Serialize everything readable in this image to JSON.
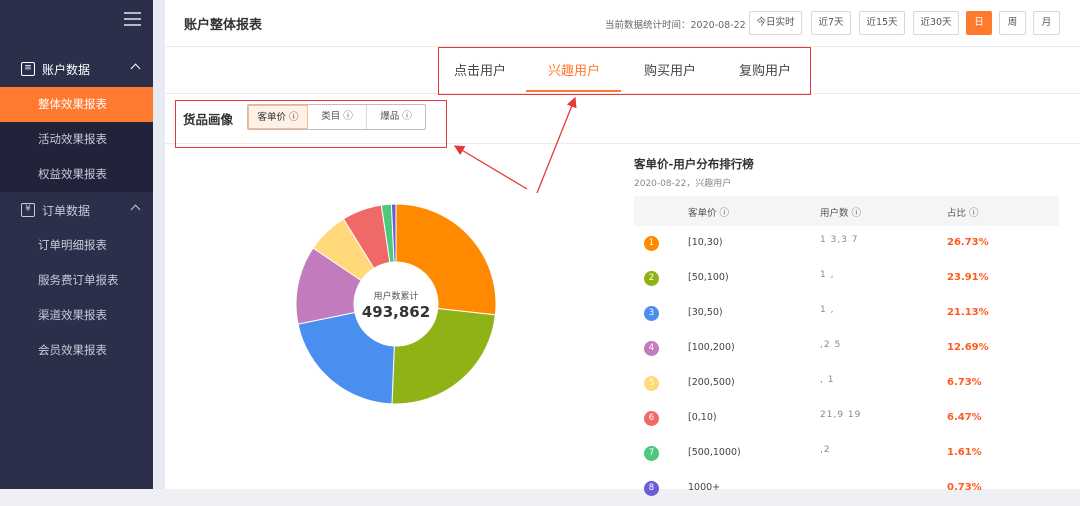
{
  "sidebar": {
    "groups": [
      {
        "label": "账户数据",
        "items": [
          "整体效果报表",
          "活动效果报表",
          "权益效果报表"
        ]
      },
      {
        "label": "订单数据",
        "items": [
          "订单明细报表",
          "服务费订单报表",
          "渠道效果报表",
          "会员效果报表"
        ]
      }
    ],
    "active_item": "整体效果报表"
  },
  "header": {
    "title": "账户整体报表",
    "stat_time": "当前数据统计时间：2020-08-22",
    "ranges": [
      "今日实时",
      "近7天",
      "近15天",
      "近30天",
      "日",
      "周",
      "月"
    ],
    "active_range": "日"
  },
  "tabs": {
    "items": [
      "点击用户",
      "兴趣用户",
      "购买用户",
      "复购用户"
    ],
    "active": "兴趣用户"
  },
  "section": {
    "label": "货品画像",
    "segments": [
      "客单价 ⓘ",
      "类目 ⓘ",
      "爆品 ⓘ"
    ],
    "active_segment": "客单价 ⓘ"
  },
  "donut": {
    "center_label": "用户数累计",
    "center_value": "493,862"
  },
  "ranking": {
    "title": "客单价-用户分布排行榜",
    "subtitle": "2020-08-22，兴趣用户",
    "columns": [
      "客单价 ⓘ",
      "用户数 ⓘ",
      "占比 ⓘ"
    ],
    "rows": [
      {
        "rank": "1",
        "range": "[10,30)",
        "count": "1 3,3 7 ",
        "pct": "26.73%",
        "color": "#ff8a00"
      },
      {
        "rank": "2",
        "range": "[50,100)",
        "count": "1   ,",
        "pct": "23.91%",
        "color": "#8fb316"
      },
      {
        "rank": "3",
        "range": "[30,50)",
        "count": "1  ,",
        "pct": "21.13%",
        "color": "#4a8ef0"
      },
      {
        "rank": "4",
        "range": "[100,200)",
        "count": "  ,2 5 ",
        "pct": "12.69%",
        "color": "#c27bbd"
      },
      {
        "rank": "5",
        "range": "[200,500)",
        "count": "  , 1",
        "pct": "6.73%",
        "color": "#ffd97a"
      },
      {
        "rank": "6",
        "range": "[0,10)",
        "count": "21,9 19",
        "pct": "6.47%",
        "color": "#f06969"
      },
      {
        "rank": "7",
        "range": "[500,1000)",
        "count": "  ,2  ",
        "pct": "1.61%",
        "color": "#4cc97a"
      },
      {
        "rank": "8",
        "range": "1000+",
        "count": "   ",
        "pct": "0.73%",
        "color": "#6a5ed6"
      }
    ]
  },
  "chart_data": {
    "type": "pie",
    "categories": [
      "[10,30)",
      "[50,100)",
      "[30,50)",
      "[100,200)",
      "[200,500)",
      "[0,10)",
      "[500,1000)",
      "1000+"
    ],
    "values": [
      26.73,
      23.91,
      21.13,
      12.69,
      6.73,
      6.47,
      1.61,
      0.73
    ],
    "colors": [
      "#ff8a00",
      "#8fb316",
      "#4a8ef0",
      "#c27bbd",
      "#ffd97a",
      "#f06969",
      "#4cc97a",
      "#6a5ed6"
    ]
  }
}
